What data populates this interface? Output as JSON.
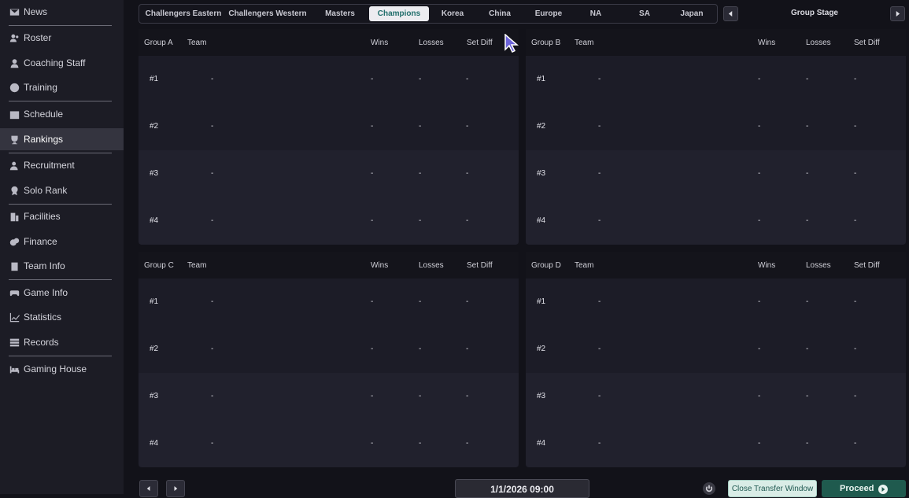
{
  "sidebar": {
    "items": [
      {
        "label": "News",
        "icon": "envelope-icon"
      },
      {
        "label": "Roster",
        "icon": "people-icon"
      },
      {
        "label": "Coaching Staff",
        "icon": "person-icon"
      },
      {
        "label": "Training",
        "icon": "soccer-ball-icon"
      },
      {
        "label": "Schedule",
        "icon": "calendar-icon"
      },
      {
        "label": "Rankings",
        "icon": "trophy-icon",
        "active": true
      },
      {
        "label": "Recruitment",
        "icon": "person-plus-icon"
      },
      {
        "label": "Solo Rank",
        "icon": "medal-icon"
      },
      {
        "label": "Facilities",
        "icon": "building-icon"
      },
      {
        "label": "Finance",
        "icon": "coins-icon"
      },
      {
        "label": "Team Info",
        "icon": "clipboard-icon"
      },
      {
        "label": "Game Info",
        "icon": "gamepad-icon"
      },
      {
        "label": "Statistics",
        "icon": "line-chart-icon"
      },
      {
        "label": "Records",
        "icon": "stack-icon"
      },
      {
        "label": "Gaming House",
        "icon": "bed-icon"
      }
    ]
  },
  "tabs": [
    {
      "label": "Challengers Eastern"
    },
    {
      "label": "Challengers Western"
    },
    {
      "label": "Masters"
    },
    {
      "label": "Champions",
      "active": true
    },
    {
      "label": "Korea"
    },
    {
      "label": "China"
    },
    {
      "label": "Europe"
    },
    {
      "label": "NA"
    },
    {
      "label": "SA"
    },
    {
      "label": "Japan"
    }
  ],
  "stage": {
    "label": "Group Stage"
  },
  "columns": {
    "team": "Team",
    "wins": "Wins",
    "losses": "Losses",
    "set_diff": "Set Diff"
  },
  "groups": [
    {
      "name": "Group A",
      "rows": [
        {
          "rank": "#1",
          "team": "-",
          "wins": "-",
          "losses": "-",
          "set_diff": "-"
        },
        {
          "rank": "#2",
          "team": "-",
          "wins": "-",
          "losses": "-",
          "set_diff": "-"
        },
        {
          "rank": "#3",
          "team": "-",
          "wins": "-",
          "losses": "-",
          "set_diff": "-"
        },
        {
          "rank": "#4",
          "team": "-",
          "wins": "-",
          "losses": "-",
          "set_diff": "-"
        }
      ]
    },
    {
      "name": "Group B",
      "rows": [
        {
          "rank": "#1",
          "team": "-",
          "wins": "-",
          "losses": "-",
          "set_diff": "-"
        },
        {
          "rank": "#2",
          "team": "-",
          "wins": "-",
          "losses": "-",
          "set_diff": "-"
        },
        {
          "rank": "#3",
          "team": "-",
          "wins": "-",
          "losses": "-",
          "set_diff": "-"
        },
        {
          "rank": "#4",
          "team": "-",
          "wins": "-",
          "losses": "-",
          "set_diff": "-"
        }
      ]
    },
    {
      "name": "Group C",
      "rows": [
        {
          "rank": "#1",
          "team": "-",
          "wins": "-",
          "losses": "-",
          "set_diff": "-"
        },
        {
          "rank": "#2",
          "team": "-",
          "wins": "-",
          "losses": "-",
          "set_diff": "-"
        },
        {
          "rank": "#3",
          "team": "-",
          "wins": "-",
          "losses": "-",
          "set_diff": "-"
        },
        {
          "rank": "#4",
          "team": "-",
          "wins": "-",
          "losses": "-",
          "set_diff": "-"
        }
      ]
    },
    {
      "name": "Group D",
      "rows": [
        {
          "rank": "#1",
          "team": "-",
          "wins": "-",
          "losses": "-",
          "set_diff": "-"
        },
        {
          "rank": "#2",
          "team": "-",
          "wins": "-",
          "losses": "-",
          "set_diff": "-"
        },
        {
          "rank": "#3",
          "team": "-",
          "wins": "-",
          "losses": "-",
          "set_diff": "-"
        },
        {
          "rank": "#4",
          "team": "-",
          "wins": "-",
          "losses": "-",
          "set_diff": "-"
        }
      ]
    }
  ],
  "footer": {
    "date": "1/1/2026 09:00",
    "close_transfer_label": "Close Transfer Window",
    "proceed_label": "Proceed"
  },
  "colors": {
    "accent": "#1f5a4e",
    "active_tab_text": "#1f6d6a"
  }
}
